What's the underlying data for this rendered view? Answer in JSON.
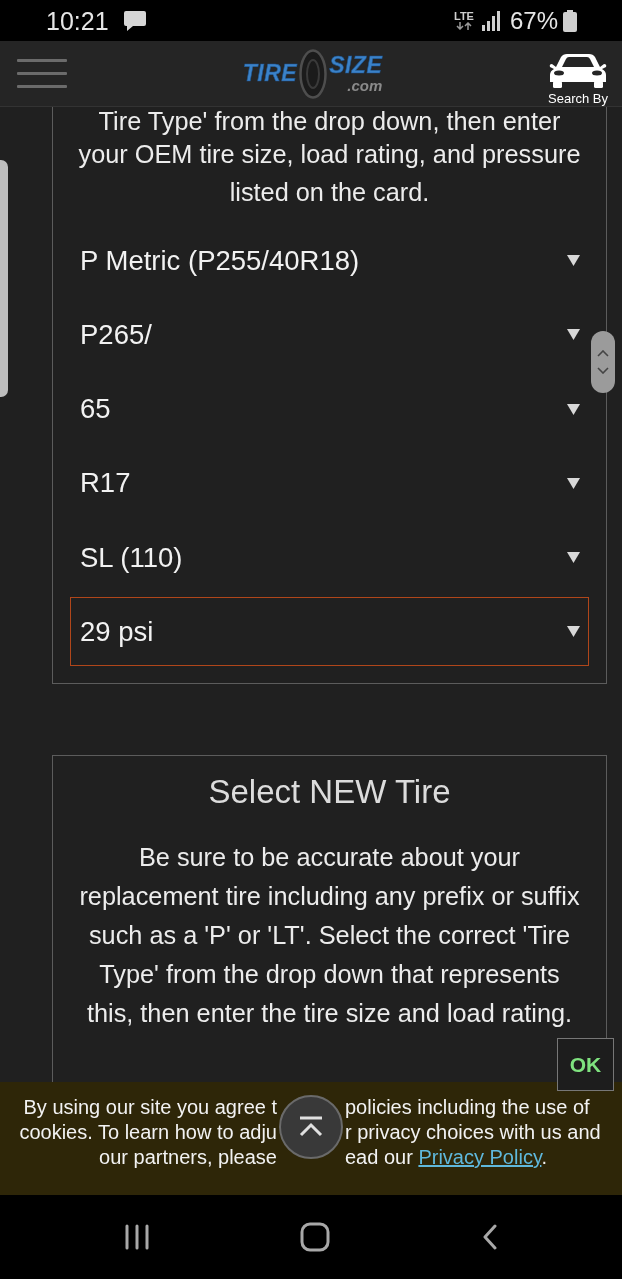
{
  "status_bar": {
    "time": "10:21",
    "network": "LTE",
    "battery": "67%"
  },
  "header": {
    "logo": {
      "word_1": "TIRE",
      "word_2": "SIZE",
      "domain": ".com"
    },
    "search_label": "Search By"
  },
  "current_tire_card": {
    "instructions_cut": "Tire Type' from the drop down, then enter",
    "instructions": "your OEM tire size, load rating, and pressure listed on the card.",
    "dropdowns": [
      {
        "value": "P Metric (P255/40R18)",
        "focused": false
      },
      {
        "value": "P265/",
        "focused": false
      },
      {
        "value": "65",
        "focused": false
      },
      {
        "value": "R17",
        "focused": false
      },
      {
        "value": "SL (110)",
        "focused": false
      },
      {
        "value": "29 psi",
        "focused": true
      }
    ]
  },
  "new_tire_card": {
    "title": "Select NEW Tire",
    "instructions": "Be sure to be accurate about your replacement tire including any prefix or suffix such as a 'P' or 'LT'. Select the correct 'Tire Type' from the drop down that represents this, then enter the tire size and load rating."
  },
  "cookie_banner": {
    "ok_button": "OK",
    "lines": [
      {
        "left": "By using our site you agree t",
        "right": "policies including the use of"
      },
      {
        "left": "cookies. To learn how to adju",
        "right": "r privacy choices with us and"
      },
      {
        "left": "our partners, please",
        "right": "ead our",
        "link": "Privacy Policy",
        "after_link": "."
      }
    ]
  }
}
